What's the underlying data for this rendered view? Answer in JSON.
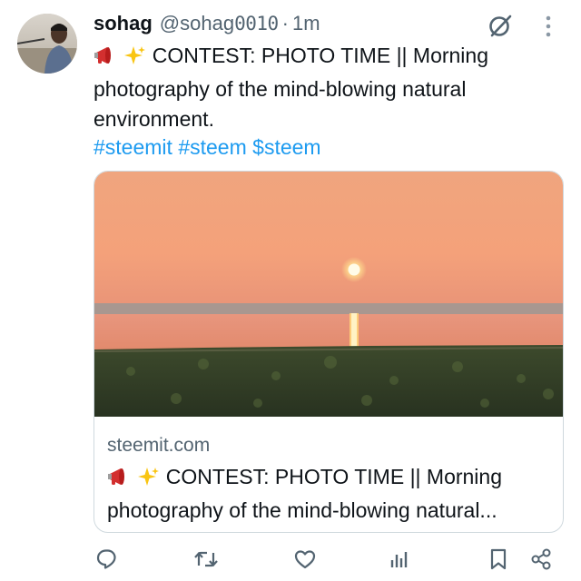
{
  "post": {
    "author_name": "sohag",
    "author_handle_prefix": "@sohag",
    "author_handle_digits": "0010",
    "separator": "·",
    "time": "1m",
    "text": "CONTEST: PHOTO TIME || Morning photography of the mind-blowing natural environment.",
    "emojis": [
      "megaphone-icon",
      "sparkles-icon"
    ],
    "hashtags": [
      "#steemit",
      "#steem",
      "$steem"
    ]
  },
  "card": {
    "domain": "steemit.com",
    "title": "CONTEST: PHOTO TIME || Morning photography of the mind-blowing natural..."
  },
  "actions": [
    "reply-icon",
    "repost-icon",
    "like-icon",
    "views-icon",
    "bookmark-icon",
    "share-icon"
  ],
  "colors": {
    "link": "#1d9bf0",
    "secondary_text": "#536471",
    "border": "#cfd9de",
    "icon": "#536471"
  }
}
